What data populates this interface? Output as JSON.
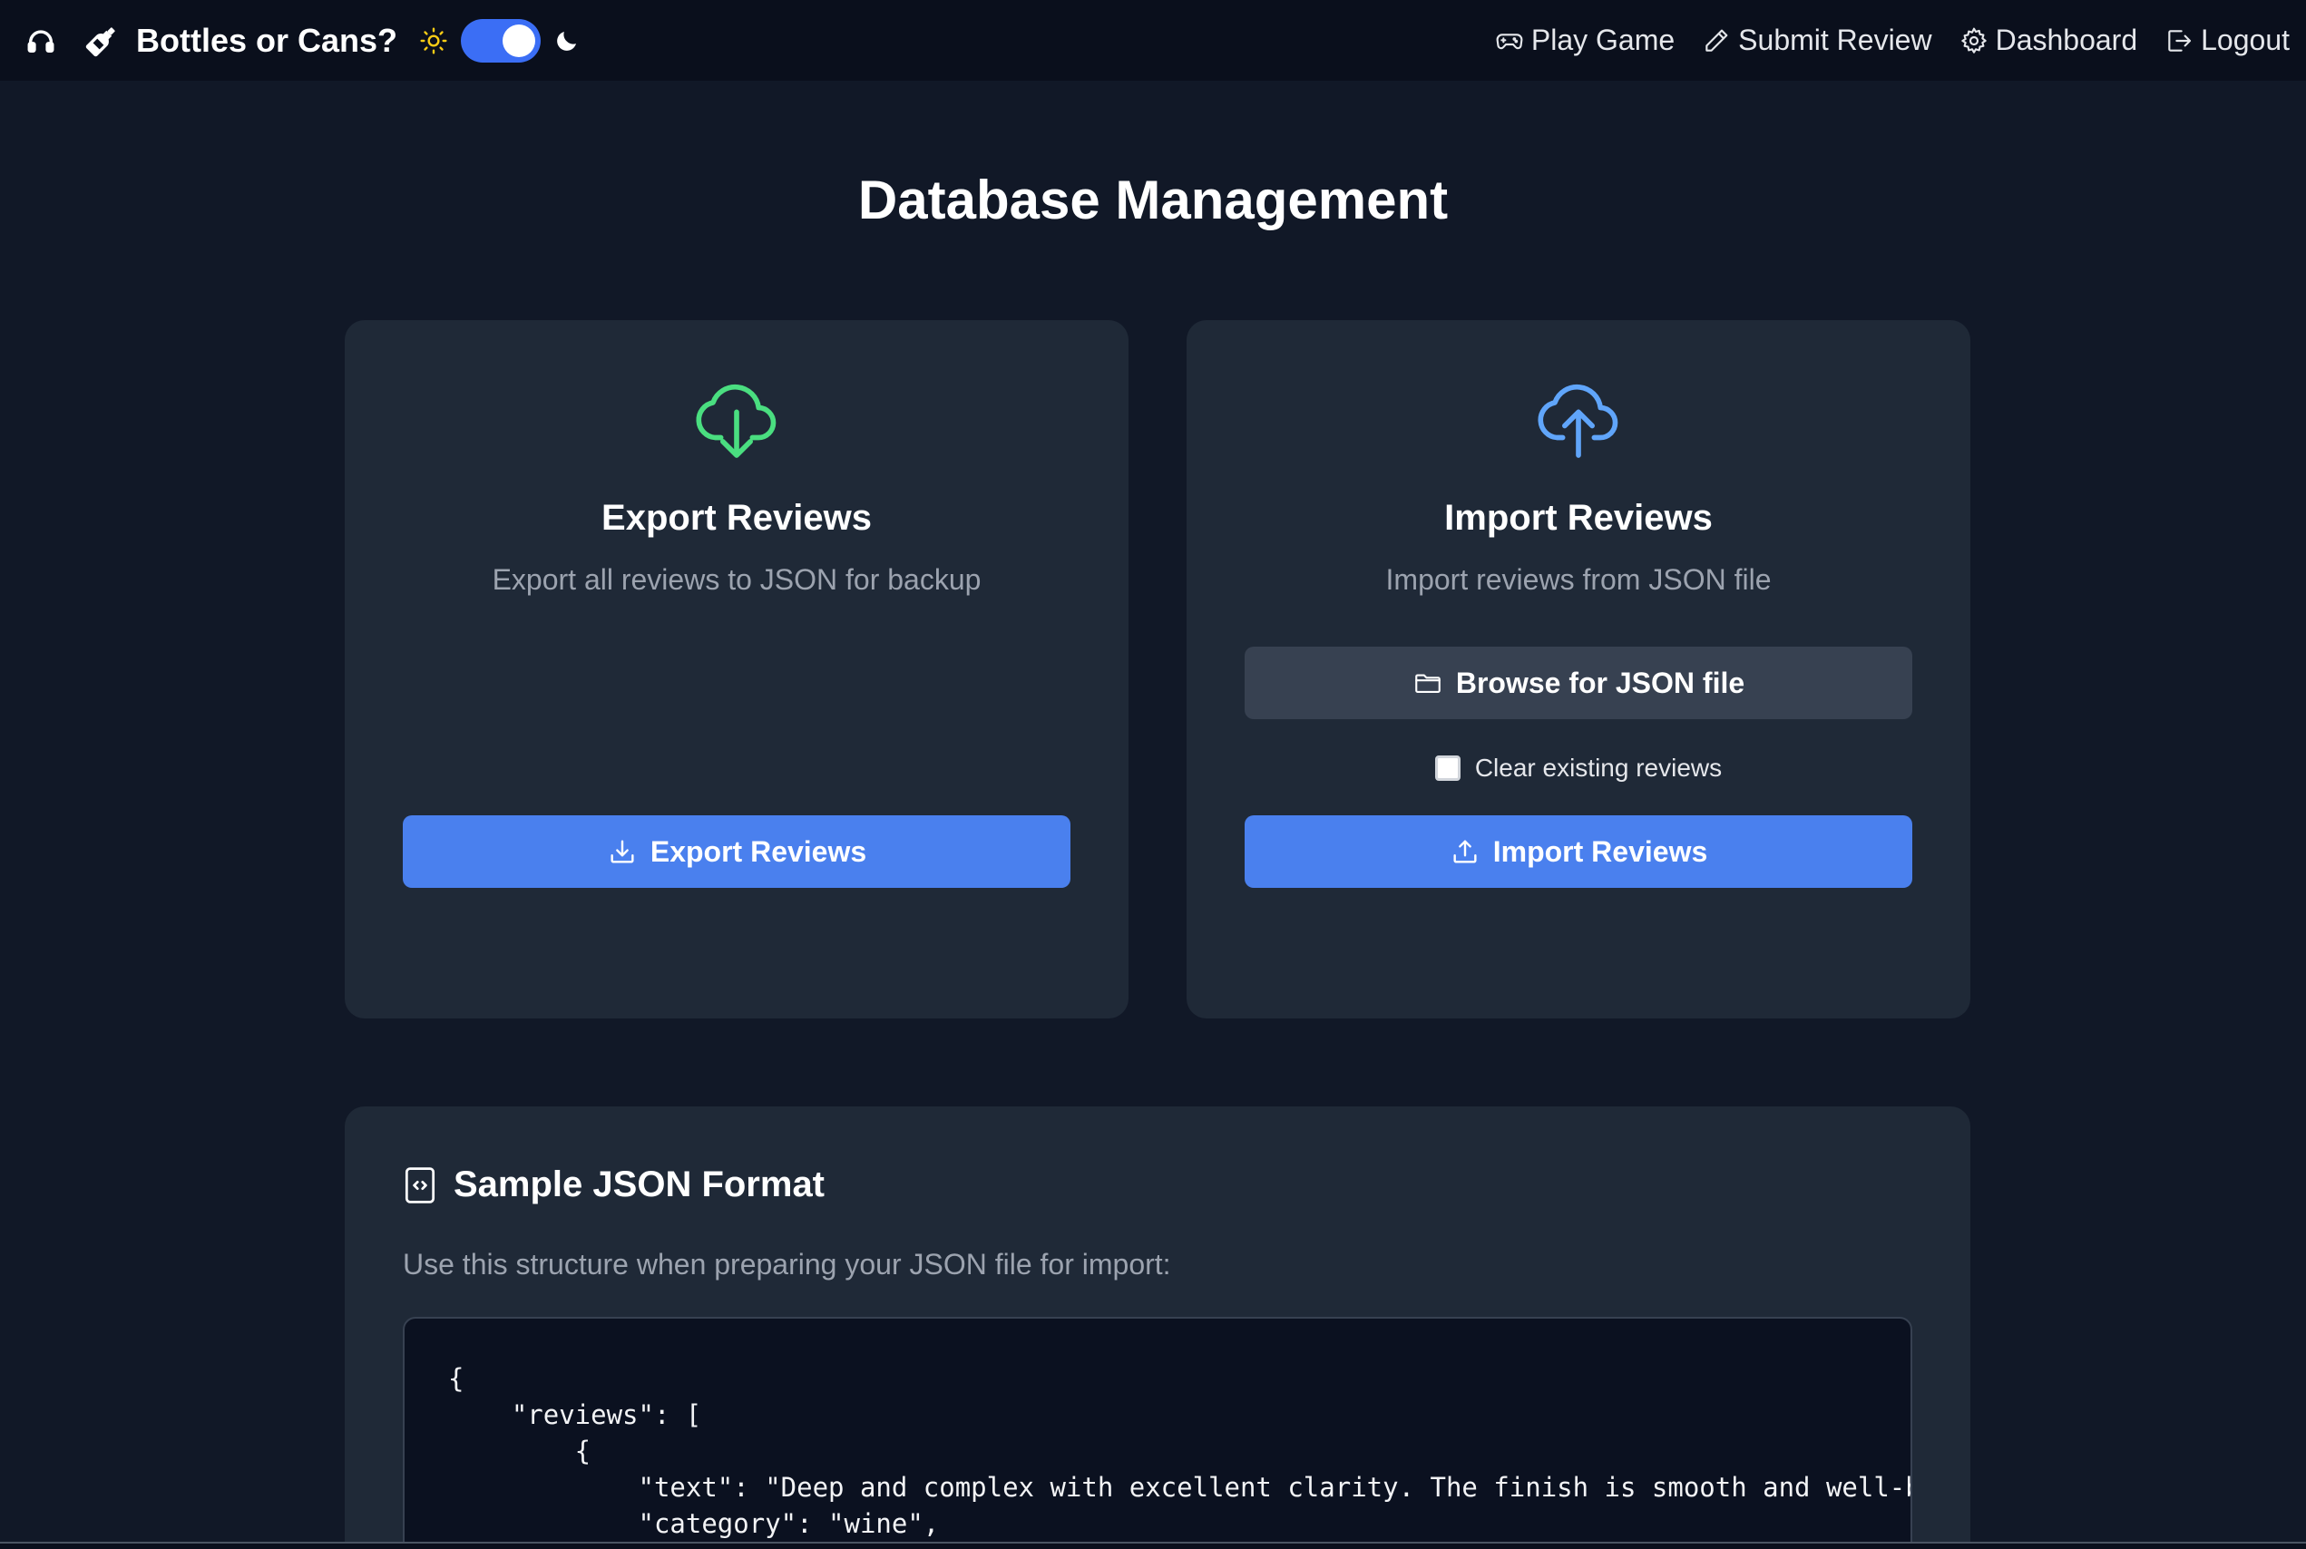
{
  "navbar": {
    "title": "Bottles or Cans?",
    "links": [
      {
        "label": "Play Game",
        "icon": "gamepad-icon"
      },
      {
        "label": "Submit Review",
        "icon": "pencil-icon"
      },
      {
        "label": "Dashboard",
        "icon": "gear-icon"
      },
      {
        "label": "Logout",
        "icon": "logout-icon"
      }
    ],
    "theme_toggle": {
      "state": "dark"
    }
  },
  "page": {
    "title": "Database Management"
  },
  "export_card": {
    "title": "Export Reviews",
    "description": "Export all reviews to JSON for backup",
    "button_label": "Export Reviews",
    "icon_color": "#4ade80"
  },
  "import_card": {
    "title": "Import Reviews",
    "description": "Import reviews from JSON file",
    "browse_label": "Browse for JSON file",
    "checkbox_label": "Clear existing reviews",
    "checkbox_checked": false,
    "button_label": "Import Reviews",
    "icon_color": "#60a5fa"
  },
  "sample_card": {
    "title": "Sample JSON Format",
    "description": "Use this structure when preparing your JSON file for import:",
    "code_lines": [
      "{",
      "    \"reviews\": [",
      "        {",
      "            \"text\": \"Deep and complex with excellent clarity. The finish is smooth and well-balanced.\",",
      "            \"category\": \"wine\","
    ]
  },
  "colors": {
    "background": "#111827",
    "navbar": "#0a0f1c",
    "card": "#1f2937",
    "primary": "#4a80ee",
    "secondary": "#374151"
  }
}
